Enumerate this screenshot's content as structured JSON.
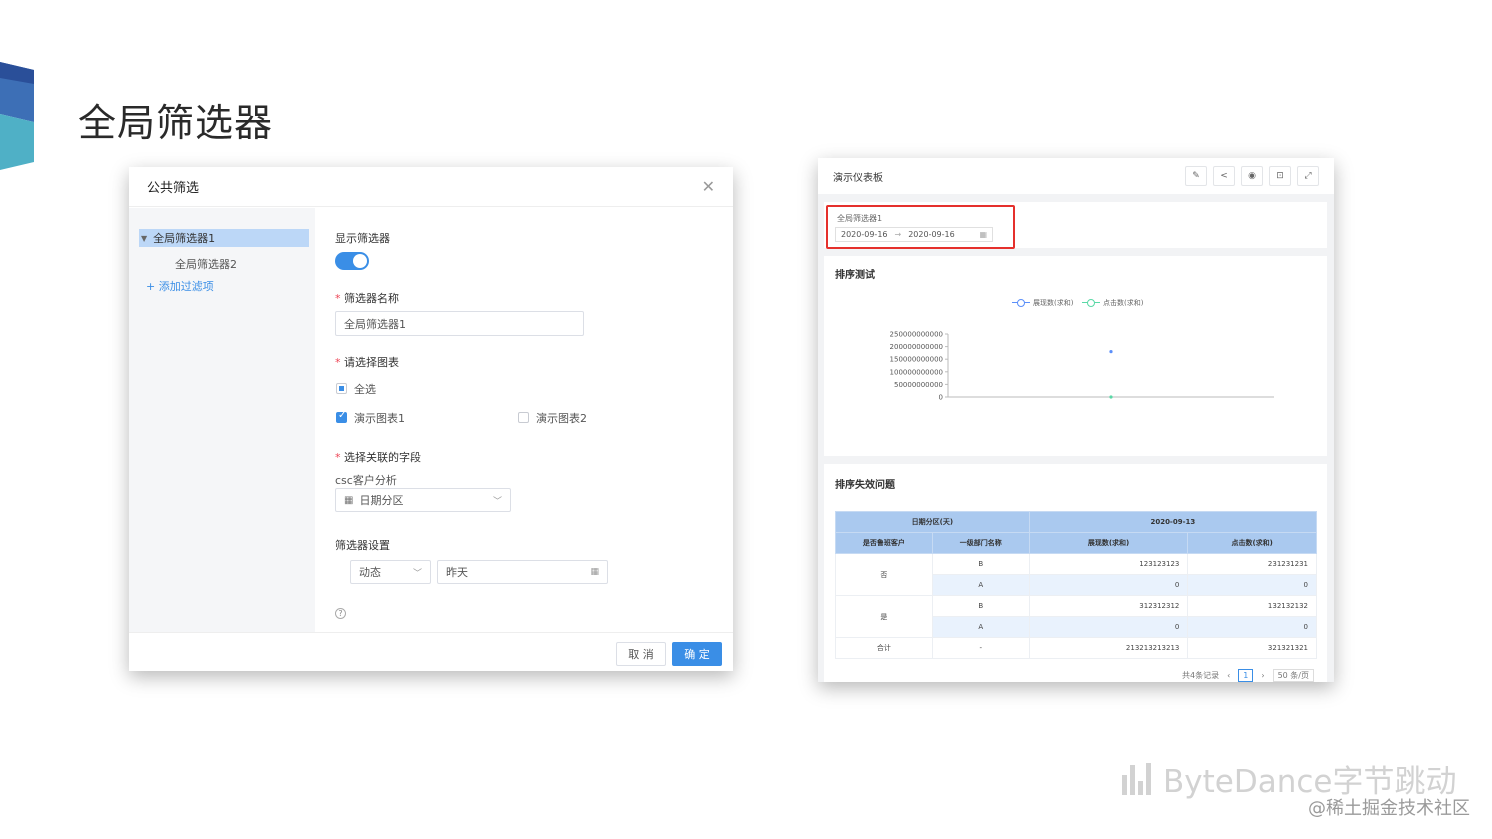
{
  "slide": {
    "title": "全局筛选器"
  },
  "dialog": {
    "title": "公共筛选",
    "close_icon": "close-icon",
    "tree": {
      "selected": "全局筛选器1",
      "child": "全局筛选器2",
      "add": "+ 添加过滤项"
    },
    "show_label": "显示筛选器",
    "show_enabled": true,
    "name_label": "筛选器名称",
    "name_value": "全局筛选器1",
    "chart_label": "请选择图表",
    "select_all": "全选",
    "chart1": "演示图表1",
    "chart2": "演示图表2",
    "field_label": "选择关联的字段",
    "dataset": "csc客户分析",
    "field_value": "日期分区",
    "settings_label": "筛选器设置",
    "mode": "动态",
    "range": "昨天",
    "cancel": "取 消",
    "ok": "确 定"
  },
  "dashboard": {
    "title": "演示仪表板",
    "filter": {
      "label": "全局筛选器1",
      "start": "2020-09-16",
      "end": "2020-09-16"
    },
    "chart_title": "排序测试",
    "table_title": "排序失效问题",
    "table": {
      "top_headers": [
        "日期分区(天)",
        "2020-09-13"
      ],
      "headers": [
        "是否鲁班客户",
        "一级部门名称",
        "展现数(求和)",
        "点击数(求和)"
      ],
      "rows": [
        [
          "否",
          "B",
          "123123123",
          "231231231"
        ],
        [
          "",
          "A",
          "0",
          "0"
        ],
        [
          "是",
          "B",
          "312312312",
          "132132132"
        ],
        [
          "",
          "A",
          "0",
          "0"
        ],
        [
          "合计",
          "-",
          "213213213213",
          "321321321"
        ]
      ]
    },
    "pager": {
      "total": "共4条记录",
      "page": "1",
      "size": "50 条/页"
    }
  },
  "chart_data": {
    "type": "line",
    "legend": [
      "展现数(求和)",
      "点击数(求和)"
    ],
    "yticks": [
      "250000000000",
      "200000000000",
      "150000000000",
      "100000000000",
      "50000000000",
      "0"
    ],
    "ylim": [
      0,
      250000000000
    ],
    "series": [
      {
        "name": "展现数(求和)",
        "values": [
          180000000000
        ],
        "color": "#5b8ff9"
      },
      {
        "name": "点击数(求和)",
        "values": [
          0
        ],
        "color": "#5ad8a6"
      }
    ]
  },
  "brand": {
    "name": "ByteDance字节跳动",
    "watermark": "@稀土掘金技术社区"
  }
}
